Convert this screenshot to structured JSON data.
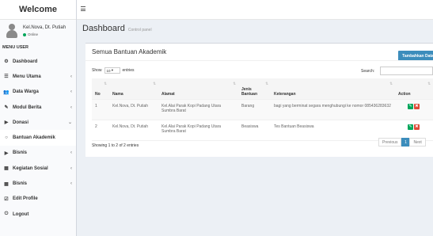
{
  "app": {
    "logo": "Welcome"
  },
  "user": {
    "name": "Kel.Nova, Dt. Putiah",
    "status": "Online"
  },
  "sidebar": {
    "header": "MENU USER",
    "items": [
      {
        "icon": "⚙",
        "label": "Dashboard",
        "chevron": ""
      },
      {
        "icon": "☰",
        "label": "Menu Utama",
        "chevron": "‹"
      },
      {
        "icon": "👥",
        "label": "Data Warga",
        "chevron": "‹"
      },
      {
        "icon": "✎",
        "label": "Modul Berita",
        "chevron": "‹"
      },
      {
        "icon": "▶",
        "label": "Donasi",
        "chevron": "⌄"
      },
      {
        "icon": "○",
        "label": "Bantuan Akademik",
        "chevron": ""
      },
      {
        "icon": "▶",
        "label": "Bisnis",
        "chevron": "‹"
      },
      {
        "icon": "▦",
        "label": "Kegiatan Sosial",
        "chevron": "‹"
      },
      {
        "icon": "▦",
        "label": "Bisnis",
        "chevron": "‹"
      },
      {
        "icon": "☑",
        "label": "Edit Profile",
        "chevron": ""
      },
      {
        "icon": "⏻",
        "label": "Logout",
        "chevron": ""
      }
    ]
  },
  "page": {
    "title": "Dashboard",
    "subtitle": "Control panel"
  },
  "box": {
    "title": "Semua Bantuan Akademik",
    "add_button": "Tambahkan Data",
    "show_label": "Show",
    "length_value": "10",
    "entries_label": "entries",
    "search_label": "Search:",
    "search_value": ""
  },
  "table": {
    "columns": [
      "No",
      "Nama",
      "Alamat",
      "Jenis Bantuan",
      "Keterangan",
      "Action"
    ],
    "rows": [
      [
        "1",
        "Kel.Nova, Dt. Putiah",
        "Kel.Alai Parak Kopi Padang Utara Sumbra Barat",
        "Barang",
        "bagi yang berminat segara menghubungi ke nomor 085436283632"
      ],
      [
        "2",
        "Kel.Nova, Dt. Putiah",
        "Kel.Alai Parak Kopi Padang Utara Sumbra Barat",
        "Beasiswa",
        "Tes Bantuan Beasiswa"
      ]
    ]
  },
  "footer": {
    "showing": "Showing 1 to 2 of 2 entries",
    "previous": "Previous",
    "current_page": "1",
    "next": "Next"
  }
}
